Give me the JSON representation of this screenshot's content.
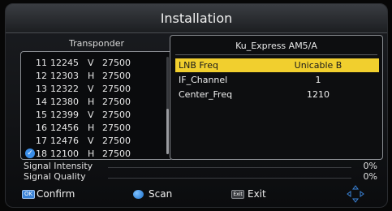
{
  "title": "Installation",
  "transponder_panel": {
    "title": "Transponder",
    "rows": [
      {
        "index": "11",
        "freq": "12245",
        "pol": "V",
        "symbol": "27500",
        "checked": false
      },
      {
        "index": "12",
        "freq": "12303",
        "pol": "H",
        "symbol": "27500",
        "checked": false
      },
      {
        "index": "13",
        "freq": "12322",
        "pol": "V",
        "symbol": "27500",
        "checked": false
      },
      {
        "index": "14",
        "freq": "12380",
        "pol": "H",
        "symbol": "27500",
        "checked": false
      },
      {
        "index": "15",
        "freq": "12399",
        "pol": "V",
        "symbol": "27500",
        "checked": false
      },
      {
        "index": "16",
        "freq": "12456",
        "pol": "H",
        "symbol": "27500",
        "checked": false
      },
      {
        "index": "17",
        "freq": "12476",
        "pol": "V",
        "symbol": "27500",
        "checked": false
      },
      {
        "index": "18",
        "freq": "12100",
        "pol": "H",
        "symbol": "27500",
        "checked": true
      }
    ]
  },
  "satellite_panel": {
    "title": "Ku_Express AM5/A",
    "params": [
      {
        "label": "LNB Freq",
        "value": "Unicable B",
        "selected": true
      },
      {
        "label": "IF_Channel",
        "value": "1",
        "selected": false
      },
      {
        "label": "Center_Freq",
        "value": "1210",
        "selected": false
      }
    ]
  },
  "signal": {
    "intensity_label": "Signal Intensity",
    "intensity_value": "0%",
    "quality_label": "Signal Quality",
    "quality_value": "0%"
  },
  "footer": {
    "ok_key": "OK",
    "confirm_label": "Confirm",
    "scan_label": "Scan",
    "exit_key": "Exit",
    "exit_label": "Exit"
  },
  "colors": {
    "highlight": "#f1cf2e",
    "check": "#3b8ee8",
    "accent_blue": "#3a82d6"
  }
}
